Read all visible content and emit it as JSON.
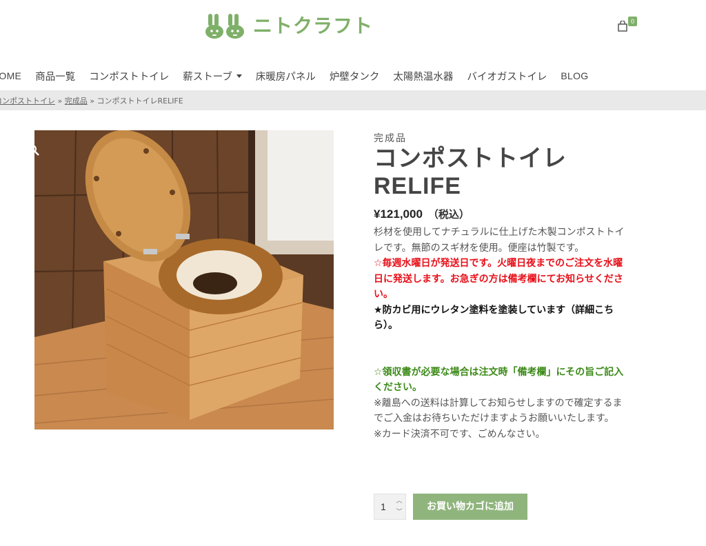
{
  "header": {
    "logo_text": "ニトクラフト",
    "cart_count": "0"
  },
  "nav": {
    "items": [
      {
        "label": "HOME"
      },
      {
        "label": "商品一覧"
      },
      {
        "label": "コンポストトイレ"
      },
      {
        "label": "薪ストーブ"
      },
      {
        "label": "床暖房パネル"
      },
      {
        "label": "炉壁タンク"
      },
      {
        "label": "太陽熱温水器"
      },
      {
        "label": "バイオガストイレ"
      },
      {
        "label": "BLOG"
      }
    ]
  },
  "breadcrumb": {
    "link1": "コンポストトイレ",
    "sep1": "»",
    "link2": "完成品",
    "sep2": "»",
    "current": "コンポストトイレRELIFE"
  },
  "product": {
    "category": "完成品",
    "title_line1": "コンポストトイレ",
    "title_line2": "RELIFE",
    "price": "¥121,000",
    "tax_note": "（税込）",
    "desc_line1": "杉材を使用してナチュラルに仕上げた木製コンポストトイ",
    "desc_line2": "レです。無節のスギ材を使用。便座は竹製です。",
    "notice_red_1": "☆毎週水曜日が発送日です。火曜日夜までのご注文を水曜",
    "notice_red_2": "日に発送します。お急ぎの方は備考欄にてお知らせくださ",
    "notice_red_3": "い。",
    "notice_black_1": "★防カビ用にウレタン塗料を塗装しています（詳細こち",
    "notice_black_2": "ら）。",
    "notice_green_1": "☆領収書が必要な場合は注文時「備考欄」にその旨ご記入",
    "notice_green_2": "ください。",
    "shipping_1": "※離島への送料は計算してお知らせしますので確定するま",
    "shipping_2": "でご入金はお待ちいただけますようお願いいたします。",
    "card_note": "※カード決済不可です、ごめんなさい。"
  },
  "cart_form": {
    "quantity": "1",
    "add_button": "お買い物カゴに追加"
  },
  "colors": {
    "brand_green": "#7fb069",
    "button_green": "#8fb57c",
    "notice_red": "#e8101a",
    "notice_green": "#3c8a18"
  },
  "icons": {
    "zoom": "magnifier-icon",
    "cart": "shopping-bag-icon",
    "logo": "rabbit-logo-icon"
  }
}
